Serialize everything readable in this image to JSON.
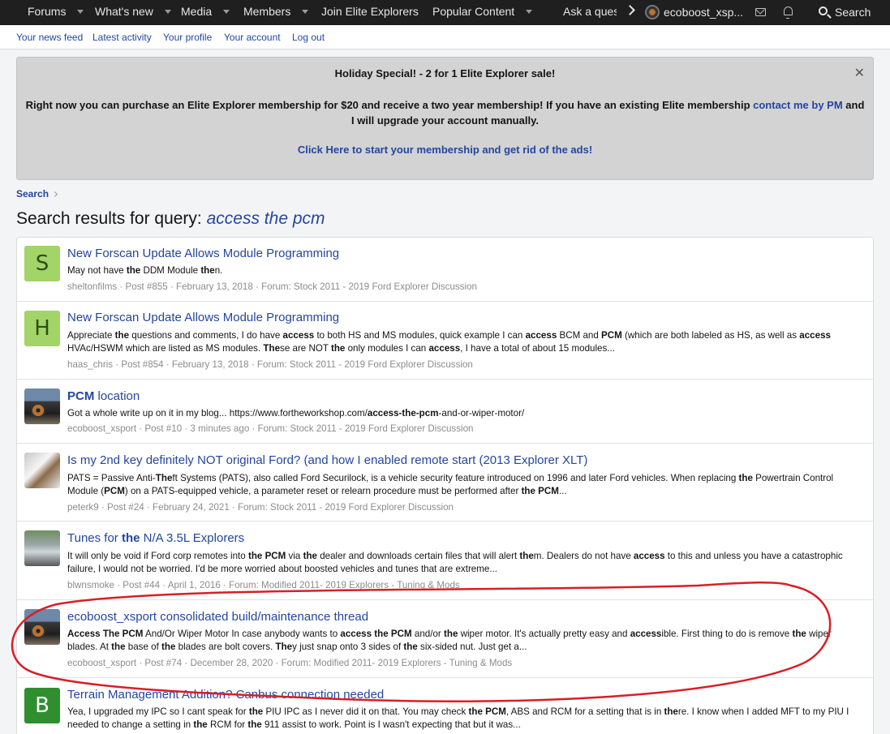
{
  "nav": {
    "items": [
      "Forums",
      "What's new",
      "Media",
      "Members",
      "Join Elite Explorers",
      "Popular Content"
    ],
    "ask": "Ask a question",
    "username": "ecoboost_xsp...",
    "search_label": "Search"
  },
  "subnav": [
    "Your news feed",
    "Latest activity",
    "Your profile",
    "Your account",
    "Log out"
  ],
  "notice": {
    "line1": "Holiday Special! - 2 for 1 Elite Explorer sale!",
    "line2_pre": "Right now you can purchase an Elite Explorer membership for $20 and receive a two year membership! If you have an existing Elite membership ",
    "line2_link": "contact me by PM",
    "line2_post": " and I will upgrade your account manually.",
    "line3_link": "Click Here to start your membership and get rid of the ads!",
    "close": "✕"
  },
  "breadcrumb": "Search",
  "page_title": {
    "prefix": "Search results for query: ",
    "query": "access the pcm"
  },
  "results": [
    {
      "avatar_letter": "S",
      "title": "New Forscan Update Allows Module Programming",
      "snippet": "May not have <b>the</b> DDM Module <b>the</b>n.",
      "meta": "sheltonfilms · Post #855 · February 13, 2018 · Forum: Stock 2011 - 2019 Ford Explorer Discussion"
    },
    {
      "avatar_letter": "H",
      "title": "New Forscan Update Allows Module Programming",
      "snippet": "Appreciate <b>the</b> questions and comments, I do have <b>access</b> to both HS and MS modules, quick example I can <b>access</b> BCM and <b>PCM</b> (which are both labeled as HS, as well as <b>access</b> HVAc/HSWM which are listed as MS modules. <b>The</b>se are NOT <b>the</b> only modules I can <b>access</b>, I have a total of about 15 modules...",
      "meta": "haas_chris · Post #854 · February 13, 2018 · Forum: Stock 2011 - 2019 Ford Explorer Discussion"
    },
    {
      "avatar_letter": "",
      "title_bold": "PCM",
      "title": " location",
      "snippet": "Got a whole write up on it in my blog... https://www.fortheworkshop.com/<b>access-the-pcm</b>-and-or-wiper-motor/",
      "meta": "ecoboost_xsport · Post #10 · 3 minutes ago · Forum: Stock 2011 - 2019 Ford Explorer Discussion"
    },
    {
      "avatar_letter": "",
      "title": "Is my 2nd key definitely NOT original Ford? (and how I enabled remote start (2013 Explorer XLT)",
      "snippet": "PATS = Passive Anti-<b>The</b>ft Systems (PATS), also called Ford Securilock, is a vehicle security feature introduced on 1996 and later Ford vehicles. When replacing <b>the</b> Powertrain Control Module (<b>PCM</b>) on a PATS-equipped vehicle, a parameter reset or relearn procedure must be performed after <b>the PCM</b>...",
      "meta": "peterk9 · Post #24 · February 24, 2021 · Forum: Stock 2011 - 2019 Ford Explorer Discussion"
    },
    {
      "avatar_letter": "",
      "title_pre": "Tunes for ",
      "title_bold": "the",
      "title": " N/A 3.5L Explorers",
      "snippet": "It will only be void if Ford corp remotes into <b>the PCM</b> via <b>the</b> dealer and downloads certain files that will alert <b>the</b>m. Dealers do not have <b>access</b> to this and unless you have a catastrophic failure, I would not be worried. I'd be more worried about boosted vehicles and tunes that are extreme...",
      "meta": "blwnsmoke · Post #44 · April 1, 2016 · Forum: Modified 2011- 2019 Explorers - Tuning & Mods"
    },
    {
      "avatar_letter": "",
      "title": "ecoboost_xsport consolidated build/maintenance thread",
      "snippet": "<b>Access The PCM</b> And/Or Wiper Motor In case anybody wants to <b>access the PCM</b> and/or <b>the</b> wiper motor. It's actually pretty easy and <b>access</b>ible. First thing to do is remove <b>the</b> wiper blades. At <b>the</b> base of <b>the</b> blades are bolt covers. <b>The</b>y just snap onto 3 sides of <b>the</b> six-sided nut. Just get a...",
      "meta": "ecoboost_xsport · Post #74 · December 28, 2020 · Forum: Modified 2011- 2019 Explorers - Tuning & Mods"
    },
    {
      "avatar_letter": "B",
      "title": "Terrain Management Addition? Canbus connection needed",
      "snippet": "Yea, I upgraded my IPC so I cant speak for <b>the</b> PIU IPC as I never did it on that. You may check <b>the PCM</b>, ABS and RCM for a setting that is in <b>the</b>re. I know when I added MFT to my PIU I needed to change a setting in <b>the</b> RCM for <b>the</b> 911 assist to work. Point is I wasn't expecting that but it was...",
      "meta": ""
    }
  ],
  "colors": {
    "link": "#2346a0",
    "nav_bg": "#1f1f1f",
    "annotation": "#d81f26"
  }
}
